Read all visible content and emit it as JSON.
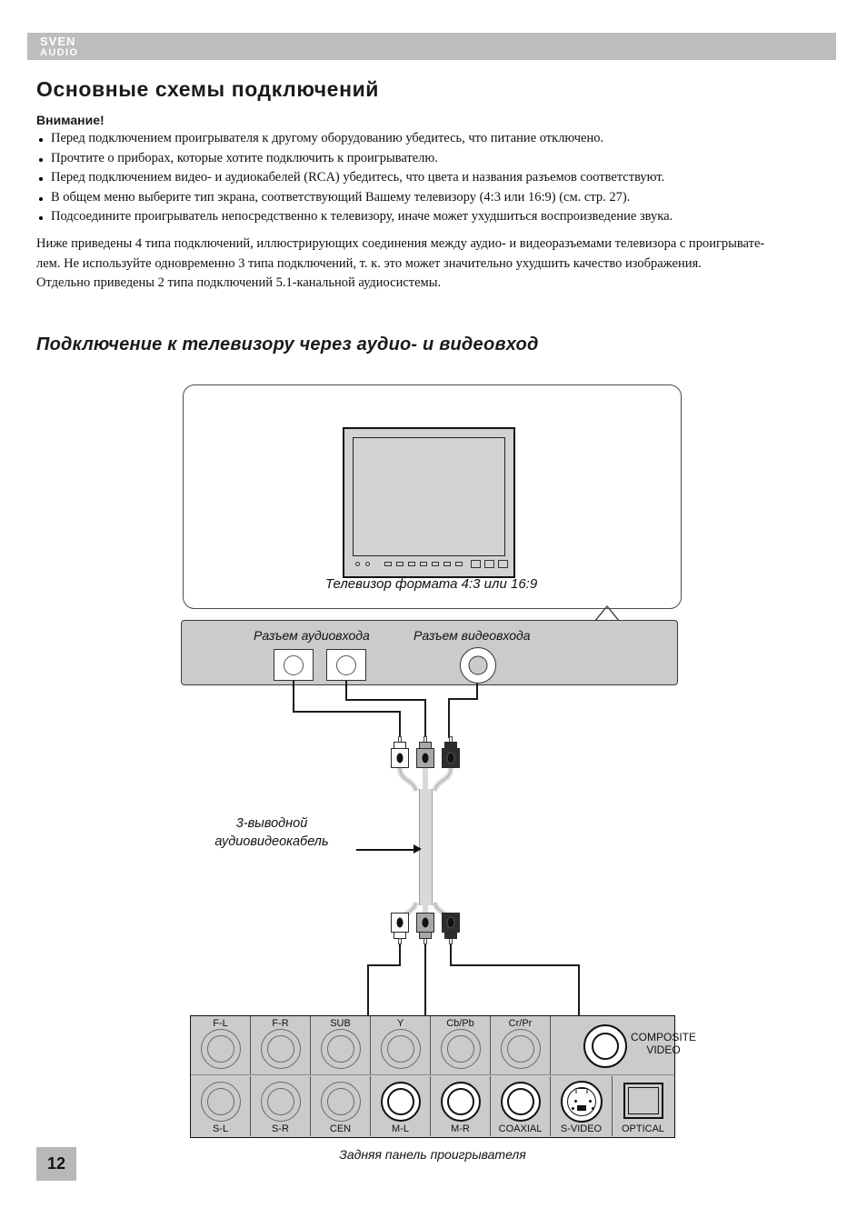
{
  "brand": {
    "line1": "SVEN",
    "line2": "AUDIO"
  },
  "headings": {
    "title": "Основные схемы подключений",
    "warning": "Внимание!",
    "section": "Подключение к телевизору через аудио- и видеовход"
  },
  "bullets": [
    "Перед подключением проигрывателя к другому оборудованию убедитесь, что питание отключено.",
    "Прочтите о приборах, которые хотите подключить к проигрывателю.",
    "Перед подключением видео- и аудиокабелей (RCA) убедитесь, что цвета и названия разъемов соответствуют.",
    "В общем меню выберите тип экрана, соответствующий Вашему телевизору (4:3 или 16:9) (см. стр. 27).",
    "Подсоедините проигрыватель непосредственно к телевизору, иначе может ухудшиться воспроизведение звука."
  ],
  "paragraph": [
    "Ниже приведены 4 типа подключений, иллюстрирующих соединения между аудио- и видеоразъемами телевизора с проигрывате-",
    "лем. Не используйте одновременно 3 типа подключений, т. к. это может значительно ухудшить качество изображения.",
    "Отдельно приведены 2 типа подключений 5.1-канальной аудиосистемы."
  ],
  "diagram": {
    "tv_caption": "Телевизор формата 4:3 или 16:9",
    "audio_input_label": "Разъем аудиовхода",
    "video_input_label": "Разъем видеовхода",
    "cable_label_line1": "3-выводной",
    "cable_label_line2": "аудиовидеокабель",
    "rear_caption": "Задняя панель проигрывателя",
    "composite_label_line1": "COMPOSITE",
    "composite_label_line2": "VIDEO"
  },
  "rear_panel": {
    "top_row": [
      "F-L",
      "F-R",
      "SUB",
      "Y",
      "Cb/Pb",
      "Cr/Pr"
    ],
    "bottom_row": [
      "S-L",
      "S-R",
      "CEN",
      "M-L",
      "M-R",
      "COAXIAL",
      "S-VIDEO",
      "OPTICAL"
    ]
  },
  "footer": {
    "page_number": "12"
  },
  "colors": {
    "header_bar": "#bdbdbd",
    "panel_gray": "#cbcbcb",
    "plug_white": "#fbfbfb",
    "plug_gray": "#a8a8a8",
    "plug_black": "#2e2e2e"
  }
}
